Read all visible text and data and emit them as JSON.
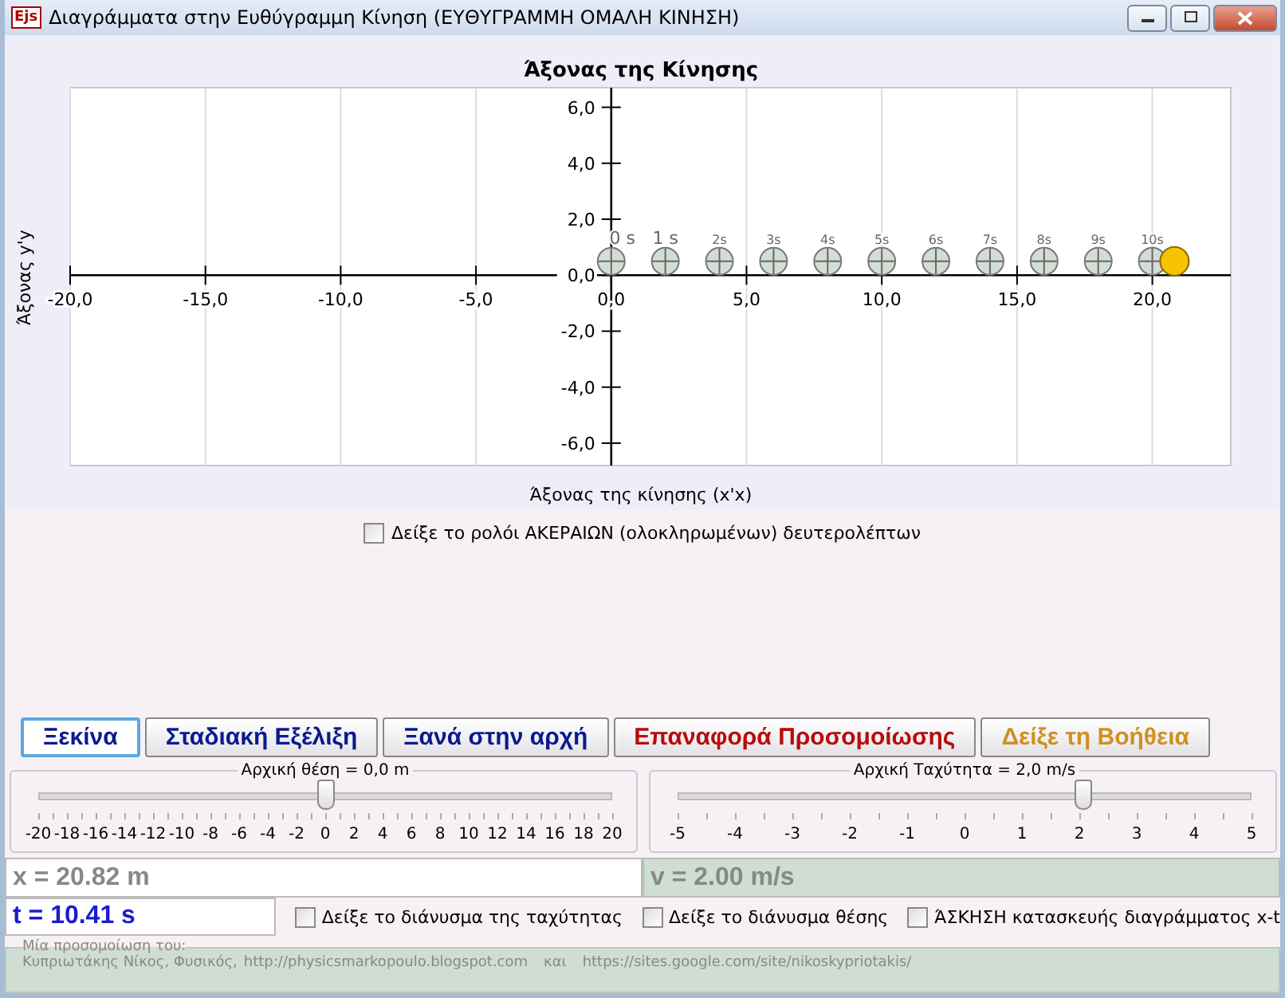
{
  "window": {
    "title": "Διαγράμματα στην Ευθύγραμμη Κίνηση (ΕΥΘΥΓΡΑΜΜΗ ΟΜΑΛΗ ΚΙΝΗΣΗ)",
    "app_badge": "Ejs"
  },
  "plot": {
    "chart_data": {
      "type": "scatter",
      "title": "Άξονας της Κίνησης",
      "xlabel": "Άξονας της κίνησης (x'x)",
      "ylabel": "Άξονας y'y",
      "x": [
        0,
        2,
        4,
        6,
        8,
        10,
        12,
        14,
        16,
        18,
        20,
        20.82
      ],
      "series": [
        {
          "color": "#d3ddd6",
          "values": [
            0.5,
            0.5,
            0.5,
            0.5,
            0.5,
            0.5,
            0.5,
            0.5,
            0.5,
            0.5,
            0.5,
            null
          ]
        },
        {
          "color": "#f7c200",
          "values": [
            null,
            null,
            null,
            null,
            null,
            null,
            null,
            null,
            null,
            null,
            null,
            0.5
          ]
        }
      ],
      "grid": true,
      "xlim": [
        -20,
        22.9
      ],
      "ylim": [
        -6.8,
        6.7
      ],
      "xticks": [
        {
          "value": -20,
          "label": "-20,0"
        },
        {
          "value": -15,
          "label": "-15,0"
        },
        {
          "value": -10,
          "label": "-10,0"
        },
        {
          "value": -5,
          "label": "-5,0"
        },
        {
          "value": 0,
          "label": "0,0"
        },
        {
          "value": 5,
          "label": "5,0"
        },
        {
          "value": 10,
          "label": "10,0"
        },
        {
          "value": 15,
          "label": "15,0"
        },
        {
          "value": 20,
          "label": "20,0"
        }
      ],
      "yticks": [
        {
          "value": -6,
          "label": "-6,0"
        },
        {
          "value": -4,
          "label": "-4,0"
        },
        {
          "value": -2,
          "label": "-2,0"
        },
        {
          "value": 0,
          "label": "0,0"
        },
        {
          "value": 2,
          "label": "2,0"
        },
        {
          "value": 4,
          "label": "4,0"
        },
        {
          "value": 6,
          "label": "6,0"
        }
      ],
      "annotations": [
        "0 s",
        "1 s",
        "2s",
        "3s",
        "4s",
        "5s",
        "6s",
        "7s",
        "8s",
        "9s",
        "10s"
      ]
    }
  },
  "clock_checkbox": {
    "label": "Δείξε το ρολόι ΑΚΕΡΑΙΩΝ (ολοκληρωμένων) δευτερολέπτων",
    "checked": false
  },
  "buttons": [
    {
      "label": "Ξεκίνα",
      "color": "#0a1a8c",
      "selected": true
    },
    {
      "label": "Σταδιακή Εξέλιξη",
      "color": "#0a1a8c",
      "selected": false
    },
    {
      "label": "Ξανά στην αρχή",
      "color": "#0a1a8c",
      "selected": false
    },
    {
      "label": "Επαναφορά Προσομοίωσης",
      "color": "#b80c0c",
      "selected": false
    },
    {
      "label": "Δείξε τη Βοήθεια",
      "color": "#d09020",
      "selected": false
    }
  ],
  "sliders": [
    {
      "title": "Αρχική θέση = 0,0 m",
      "level": 0.5,
      "ticks": [
        "-20",
        "-18",
        "-16",
        "-14",
        "-12",
        "-10",
        "-8",
        "-6",
        "-4",
        "-2",
        "0",
        "2",
        "4",
        "6",
        "8",
        "10",
        "12",
        "14",
        "16",
        "18",
        "20"
      ]
    },
    {
      "title": "Αρχική Ταχύτητα = 2,0 m/s",
      "level": 0.7,
      "ticks": [
        "-5",
        "-4",
        "-3",
        "-2",
        "-1",
        "0",
        "1",
        "2",
        "3",
        "4",
        "5"
      ]
    }
  ],
  "position_display": {
    "value": "x = 20.82 m"
  },
  "velocity_display": {
    "value": "v = 2.00 m/s"
  },
  "time_display": {
    "value": "t = 10.41 s"
  },
  "options": [
    {
      "label": "Δείξε το διάνυσμα της ταχύτητας",
      "checked": false
    },
    {
      "label": "Δείξε το διάνυσμα θέσης",
      "checked": false
    },
    {
      "label": "ΆΣΚΗΣΗ κατασκευής διαγράμματος x-t",
      "checked": false
    }
  ],
  "credits": {
    "title": "Μία προσομοίωση του:",
    "author": "Κυπριωτάκης Νίκος, Φυσικός,",
    "links": [
      {
        "text": "http://physicsmarkopoulo.blogspot.com"
      },
      {
        "text": "και"
      },
      {
        "text": "https://sites.google.com/site/nikoskypriotakis/"
      }
    ]
  }
}
